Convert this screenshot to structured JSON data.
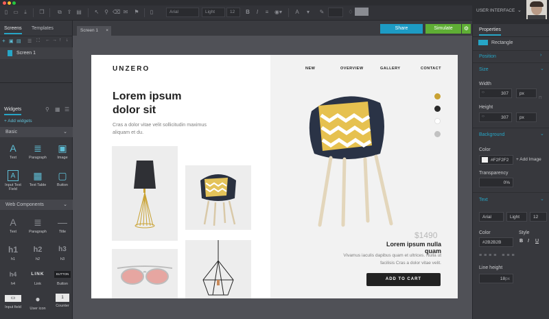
{
  "toolbar": {
    "font_family": "Arial",
    "font_weight": "Light",
    "font_size": "12",
    "bold": "B",
    "italic": "I",
    "underline": "U",
    "text_icon": "A"
  },
  "user": {
    "label": "USER INTERFACE"
  },
  "left": {
    "tabs": [
      "Screens",
      "Templates"
    ],
    "screen_item": "Screen 1",
    "widgets_tab": "Widgets",
    "add_widgets": "+ Add widgets",
    "basic_header": "Basic",
    "basic_widgets": [
      {
        "label": "Text",
        "icon": "A"
      },
      {
        "label": "Paragraph",
        "icon": "≣"
      },
      {
        "label": "Image",
        "icon": "▣"
      },
      {
        "label": "Input Text Field",
        "icon": "A"
      },
      {
        "label": "Text Table",
        "icon": "▦"
      },
      {
        "label": "Button",
        "icon": "▢"
      }
    ],
    "web_header": "Web Components",
    "web_widgets": [
      {
        "label": "Text",
        "icon": "A"
      },
      {
        "label": "Paragraph",
        "icon": "≣"
      },
      {
        "label": "Title",
        "icon": "—"
      },
      {
        "label": "h1",
        "icon": "h1"
      },
      {
        "label": "h2",
        "icon": "h2"
      },
      {
        "label": "h3",
        "icon": "h3"
      },
      {
        "label": "h4",
        "icon": "h4"
      },
      {
        "label": "Link",
        "icon": "LINK"
      },
      {
        "label": "Button",
        "icon": "BUTTON"
      },
      {
        "label": "Input field",
        "icon": "▭"
      },
      {
        "label": "User icon",
        "icon": "●"
      },
      {
        "label": "Counter",
        "icon": "1"
      }
    ]
  },
  "canvas": {
    "tab": "Screen 1",
    "share": "Share",
    "simulate": "Simulate"
  },
  "site": {
    "logo": "UNZERO",
    "nav": [
      "NEW",
      "OVERVIEW",
      "GALLERY",
      "CONTACT"
    ],
    "headline": "Lorem ipsum dolor sit",
    "subtext": "Cras a dolor vitae velit sollicitudin maximus aliquam et du.",
    "price": "$1490",
    "product_title": "Lorem ipsum nulla quam",
    "product_desc": "Vivamus iaculis dapibus quam et ultrices. Nulla ut facilisis Cras a dolor vitae velit.",
    "cta": "ADD TO CART",
    "swatches": [
      "#c9a233",
      "#2b2b2b",
      "#ffffff",
      "#c2c2c2"
    ]
  },
  "props": {
    "tab": "Properties",
    "element": "Rectangle",
    "position": "Position",
    "size": "Size",
    "width_label": "Width",
    "width": "307",
    "height_label": "Height",
    "height": "307",
    "unit": "px",
    "background": "Background",
    "color_label": "Color",
    "bg_color": "#F2F2F2",
    "add_image": "+ Add Image",
    "transparency_label": "Transparency",
    "transparency": "0%",
    "text": "Text",
    "font": "Arial",
    "weight": "Light",
    "size_val": "12",
    "text_color_label": "Color",
    "text_color": "#2B2B2B",
    "style_label": "Style",
    "line_height_label": "Line height",
    "line_height": "18",
    "accent": "#26a6c7"
  }
}
